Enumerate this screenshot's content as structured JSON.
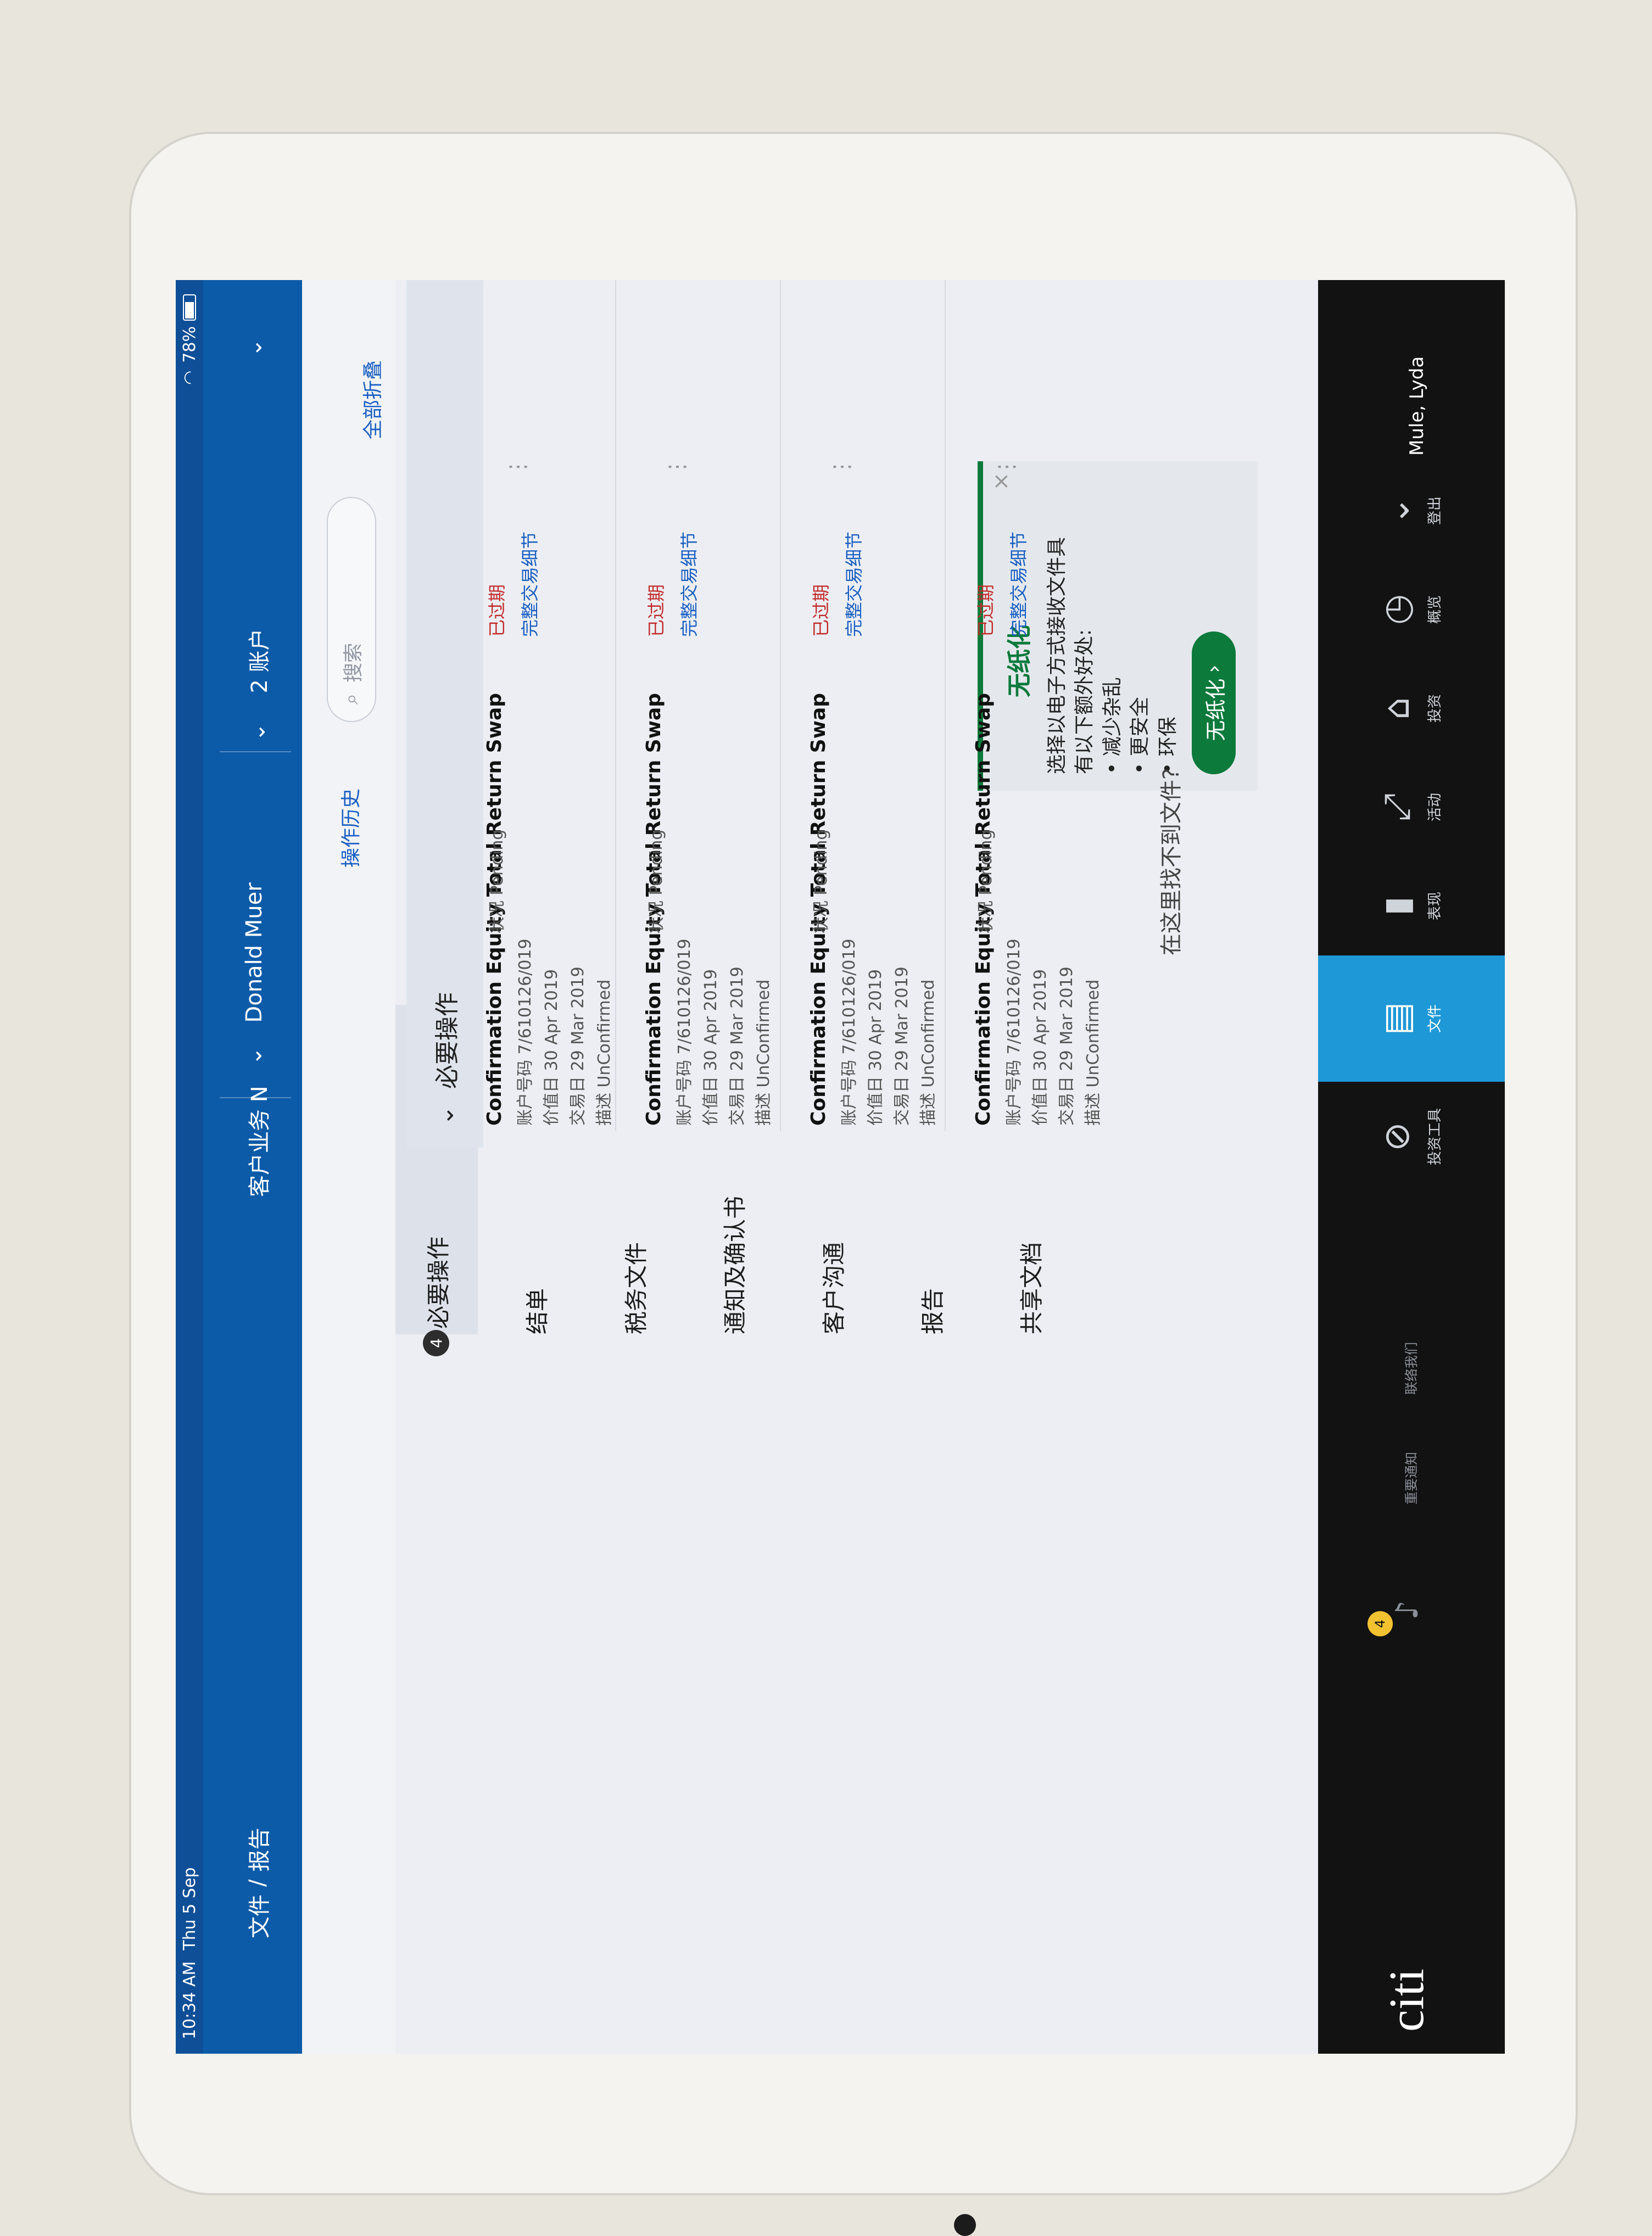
{
  "status_bar": {
    "time": "10:34 AM",
    "date": "Thu 5 Sep",
    "battery": "78%"
  },
  "top_nav": {
    "breadcrumb_parent": "文件",
    "breadcrumb_sep": "/",
    "breadcrumb_current": "报告",
    "client": "客户业务 N",
    "person": "Donald Muer",
    "accounts": "2 账户"
  },
  "toolbar": {
    "history_label": "操作历史",
    "search_placeholder": "搜索",
    "collapse_all": "全部折叠"
  },
  "sidebar": {
    "user_name": "Mule, Lyda",
    "logout": "登出",
    "items": [
      {
        "label": "概览",
        "icon": "◷"
      },
      {
        "label": "投资",
        "icon": "⌂"
      },
      {
        "label": "活动",
        "icon": "⤢"
      },
      {
        "label": "表现",
        "icon": "▮"
      },
      {
        "label": "文件",
        "icon": "▤"
      },
      {
        "label": "投资工具",
        "icon": "⊘"
      }
    ],
    "contact": "联络我们",
    "important": "重要通知",
    "notif_count": "4",
    "logo": "citi"
  },
  "doc_menu": {
    "items": [
      {
        "label": "必要操作",
        "badge": "4"
      },
      {
        "label": "结单"
      },
      {
        "label": "税务文件"
      },
      {
        "label": "通知及确认书"
      },
      {
        "label": "客户沟通"
      },
      {
        "label": "报告"
      },
      {
        "label": "共享文档"
      }
    ]
  },
  "paperless": {
    "title": "无纸化",
    "line1": "选择以电子方式接收文件具",
    "line2": "有以下额外好处:",
    "bullets": [
      "减少杂乱",
      "更安全",
      "环保"
    ],
    "button": "无纸化",
    "close": "×"
  },
  "section": {
    "title": "必要操作"
  },
  "transactions": [
    {
      "title": "Confirmation Equity Total Return Swap",
      "account": "账户号码 7/610126/019",
      "value_date": "价值日 30 Apr 2019",
      "trade_date": "交易日 29 Mar 2019",
      "desc": "描述 UnConfirmed",
      "status": "状况 Pending",
      "expired": "已过期",
      "detail": "完整交易细节"
    },
    {
      "title": "Confirmation Equity Total Return Swap",
      "account": "账户号码 7/610126/019",
      "value_date": "价值日 30 Apr 2019",
      "trade_date": "交易日 29 Mar 2019",
      "desc": "描述 UnConfirmed",
      "status": "状况 Pending",
      "expired": "已过期",
      "detail": "完整交易细节"
    },
    {
      "title": "Confirmation Equity Total Return Swap",
      "account": "账户号码 7/610126/019",
      "value_date": "价值日 30 Apr 2019",
      "trade_date": "交易日 29 Mar 2019",
      "desc": "描述 UnConfirmed",
      "status": "状况 Pending",
      "expired": "已过期",
      "detail": "完整交易细节"
    },
    {
      "title": "Confirmation Equity Total Return Swap",
      "account": "账户号码 7/610126/019",
      "value_date": "价值日 30 Apr 2019",
      "trade_date": "交易日 29 Mar 2019",
      "desc": "描述 UnConfirmed",
      "status": "状况 Pending",
      "expired": "已过期",
      "detail": "完整交易细节"
    }
  ],
  "not_found": "在这里找不到文件?"
}
